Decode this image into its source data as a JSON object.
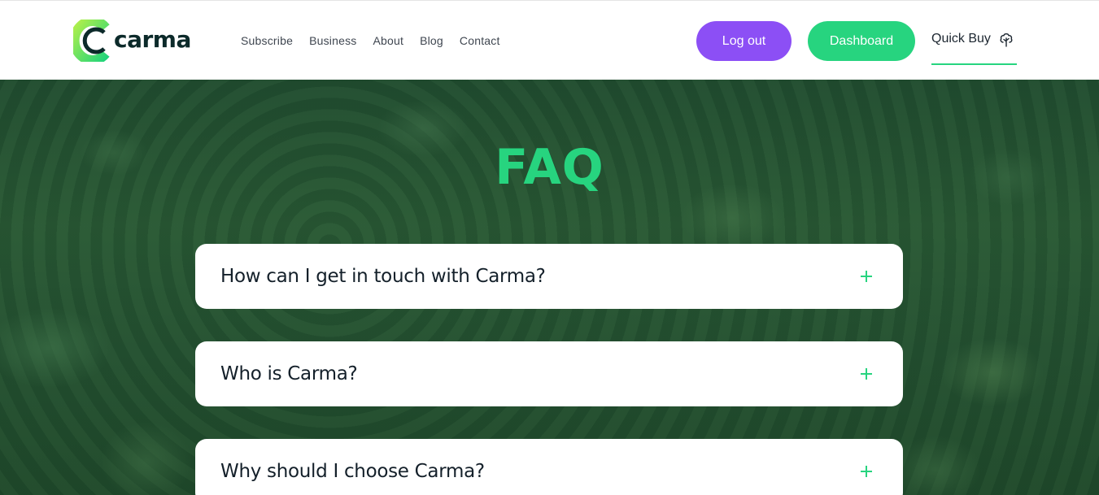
{
  "header": {
    "logo_text": "carma",
    "nav": [
      {
        "label": "Subscribe"
      },
      {
        "label": "Business"
      },
      {
        "label": "About"
      },
      {
        "label": "Blog"
      },
      {
        "label": "Contact"
      }
    ],
    "logout_label": "Log out",
    "dashboard_label": "Dashboard",
    "quick_buy_label": "Quick Buy",
    "quick_buy_icon": "tree-icon"
  },
  "faq": {
    "title": "FAQ",
    "items": [
      {
        "question": "How can I get in touch with Carma?"
      },
      {
        "question": "Who is Carma?"
      },
      {
        "question": "Why should I choose Carma?"
      }
    ]
  },
  "colors": {
    "brand_green": "#27d47f",
    "logout_purple": "#8c4ff5",
    "logo_dark": "#0c2a2a"
  }
}
